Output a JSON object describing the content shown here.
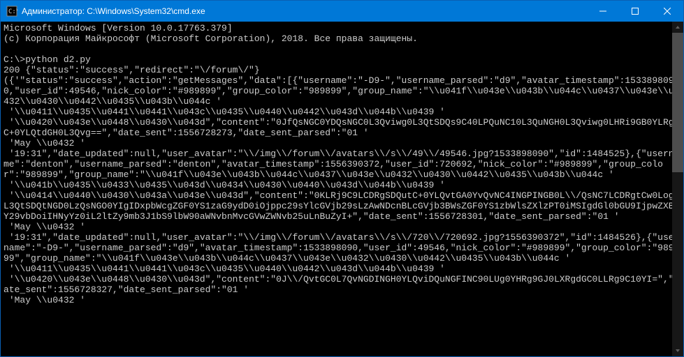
{
  "titlebar": {
    "title": "Администратор: C:\\Windows\\System32\\cmd.exe"
  },
  "terminal": {
    "lines": "Microsoft Windows [Version 10.0.17763.379]\n(c) Корпорация Майкрософт (Microsoft Corporation), 2018. Все права защищены.\n\nC:\\>python d2.py\n200 {\"status\":\"success\",\"redirect\":\"\\/forum\\/\"}\n({'\"status\":\"success\",\"action\":\"getMessages\",\"data\":[{\"username\":\"-D9-\",\"username_parsed\":\"d9\",\"avatar_timestamp\":1533898090,\"user_id\":49546,\"nick_color\":\"#989899\",\"group_color\":\"989899\",\"group_name\":\"\\\\u041f\\\\u043e\\\\u043b\\\\u044c\\\\u0437\\\\u043e\\\\u0432\\\\u0430\\\\u0442\\\\u0435\\\\u043b\\\\u044c '\n '\\\\u0411\\\\u0435\\\\u0441\\\\u0441\\\\u043c\\\\u0435\\\\u0440\\\\u0442\\\\u043d\\\\u044b\\\\u0439 '\n '\\\\u0420\\\\u043e\\\\u0448\\\\u0430\\\\u043d\",\"content\":\"0JfQsNGC0YDQsNGC0L3Qviwg0L3QtSDQs9C40LPQuNC10L3QuNGH0L3Qviwg0LHRi9GB0YLRgNC+0YLQtdGH0L3Qvg==\",\"date_sent\":1556728273,\"date_sent_parsed\":\"01 '\n 'May \\\\u0432 '\n '19:31\",\"date_updated\":null,\"user_avatar\":\"\\\\/img\\\\/forum\\\\/avatars\\\\/s\\\\/49\\\\/49546.jpg?1533898090\",\"id\":1484525},{\"username\":\"denton\",\"username_parsed\":\"denton\",\"avatar_timestamp\":1556390372,\"user_id\":720692,\"nick_color\":\"#989899\",\"group_color\":\"989899\",\"group_name\":\"\\\\u041f\\\\u043e\\\\u043b\\\\u044c\\\\u0437\\\\u043e\\\\u0432\\\\u0430\\\\u0442\\\\u0435\\\\u043b\\\\u044c '\n '\\\\u041b\\\\u0435\\\\u0433\\\\u0435\\\\u043d\\\\u0434\\\\u0430\\\\u0440\\\\u043d\\\\u044b\\\\u0439 '\n '\\\\u0414\\\\u0440\\\\u0430\\\\u043a\\\\u043e\\\\u043d\",\"content\":\"0KLRj9C9LCDRgSDQutC+0YLQvtGA0YvQvNC4INGPINGB0L\\\\/QsNC7LCDRgtCw0Log0L3QtSDQtNGD0LzQsNGO0YIgIDxpbWcgZGF0YS1zaG9ydD0iOjppc29sYlcGVjb29sLzAwNDcnBLcGVjb3BWsZGF0YS1zbWlsZXlzPT0iMSIgdGl0bGU9IjpwZXBlY29vbDoiIHNyYz0iL2ltZy9mb3J1bS9lbW90aWNvbnMvcGVwZWNvb25uLnBuZyI+\",\"date_sent\":1556728301,\"date_sent_parsed\":\"01 '\n 'May \\\\u0432 '\n '19:31\",\"date_updated\":null,\"user_avatar\":\"\\\\/img\\\\/forum\\\\/avatars\\\\/s\\\\/720\\\\/720692.jpg?1556390372\",\"id\":1484526},{\"username\":\"-D9-\",\"username_parsed\":\"d9\",\"avatar_timestamp\":1533898090,\"user_id\":49546,\"nick_color\":\"#989899\",\"group_color\":\"989899\",\"group_name\":\"\\\\u041f\\\\u043e\\\\u043b\\\\u044c\\\\u0437\\\\u043e\\\\u0432\\\\u0430\\\\u0442\\\\u0435\\\\u043b\\\\u044c '\n '\\\\u0411\\\\u0435\\\\u0441\\\\u0441\\\\u043c\\\\u0435\\\\u0440\\\\u0442\\\\u043d\\\\u044b\\\\u0439 '\n '\\\\u0420\\\\u043e\\\\u0448\\\\u0430\\\\u043d\",\"content\":\"0J\\\\/QvtGC0L7QvNGDINGH0YLQviDQuNGFINC90LUg0YHRg9GJ0LXRgdGC0LLRg9C10YI=\",\"date_sent\":1556728327,\"date_sent_parsed\":\"01 '\n 'May \\\\u0432 '"
  }
}
